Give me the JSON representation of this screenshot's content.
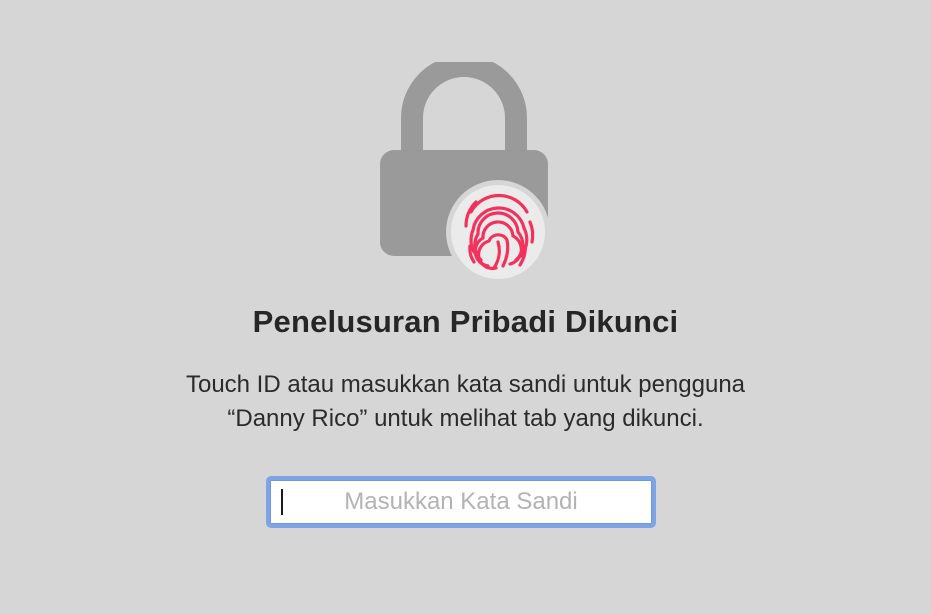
{
  "lock_screen": {
    "title": "Penelusuran Pribadi Dikunci",
    "description_line1": "Touch ID atau masukkan kata sandi untuk pengguna",
    "description_line2": "“Danny Rico” untuk melihat tab yang dikunci.",
    "password_placeholder": "Masukkan Kata Sandi",
    "password_value": "",
    "icons": {
      "lock": "lock-icon",
      "touch_id": "fingerprint-icon"
    },
    "colors": {
      "background": "#d6d6d6",
      "lock_gray": "#9a9a9a",
      "fingerprint": "#f2325d",
      "focus_ring": "#7fa4e6"
    }
  }
}
